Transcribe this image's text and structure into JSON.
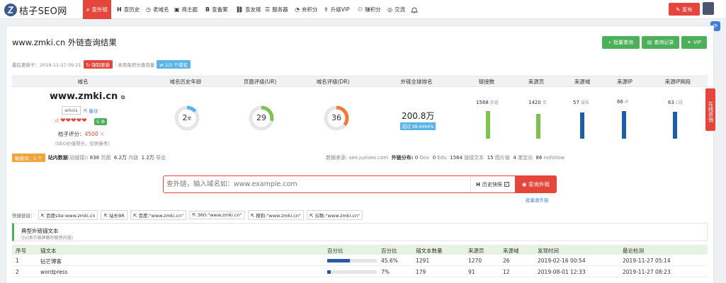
{
  "brand": {
    "name": "桔子SEO网"
  },
  "nav": {
    "items": [
      {
        "glyph": "⌕",
        "label": "查外链"
      },
      {
        "glyph": "H",
        "label": "查历史"
      },
      {
        "glyph": "◷",
        "label": "老域名"
      },
      {
        "glyph": "▣",
        "label": "商主题"
      },
      {
        "glyph": "B",
        "label": "查备案"
      },
      {
        "glyph": "⛓",
        "label": "查友链"
      },
      {
        "glyph": "☰",
        "label": "服务器"
      },
      {
        "glyph": "◔",
        "label": "充积分"
      },
      {
        "glyph": "⇪",
        "label": "升级VIP"
      },
      {
        "glyph": "⚇",
        "label": "赚积分"
      },
      {
        "glyph": "◎",
        "label": "交流"
      }
    ],
    "publish": "发布"
  },
  "header": {
    "title": "www.zmki.cn 外链查询结果",
    "buttons": {
      "batch": "批量查询",
      "records": "查询记录",
      "vip": "VIP"
    }
  },
  "meta": {
    "updated": "最后更新于：2019-11-27 09:21",
    "force": "强制更新",
    "free": "本周免积分查询量",
    "quota": "2/2 个域名"
  },
  "stats": {
    "headers": [
      "域名",
      "域名历史年龄",
      "页面评级(UR)",
      "域名评级(DR)",
      "外链全球排名",
      "链接数",
      "来源页",
      "来源域",
      "来源IP",
      "来源IP网段"
    ],
    "domain": "www.zmki.cn",
    "whois": "whois",
    "beian": "备住",
    "hearts": "❤❤❤❤❤",
    "heart_badge": "5",
    "score_label": "桔子评分：",
    "score": "4500 ☆",
    "score_note": "(SEO价值得分，仅供参考)",
    "age": "2",
    "age_unit": "年",
    "age_ratio": 0.14,
    "ur": 29,
    "dr": 36,
    "rank": "200.8万",
    "rank_pct": "超过 98.6494%",
    "counts": [
      {
        "value": "1568",
        "unit": "外链",
        "level": 0.75,
        "color": "#7dc34f"
      },
      {
        "value": "1420",
        "unit": "页",
        "level": 0.68,
        "color": "#7dc34f"
      },
      {
        "value": "57",
        "unit": "域名",
        "level": 0.72,
        "color": "#1c5fa8"
      },
      {
        "value": "66",
        "unit": "IP",
        "level": 0.75,
        "color": "#1c5fa8"
      },
      {
        "value": "63",
        "unit": "C段",
        "level": 0.73,
        "color": "#1c5fa8"
      }
    ]
  },
  "ext": {
    "keyword": "敏感词：1 个",
    "site_label": "站内数据",
    "site_note": "(站链接)",
    "n838": "838",
    "pages": "页面",
    "n62": "6.2万",
    "inner": "内链",
    "n12": "1.2万",
    "out": "导出",
    "source": "数据来源: seo.juziseo.com",
    "dist": "外链分布:",
    "gov_n": "0",
    "gov": "Gov",
    "edu_n": "0",
    "edu": "Edu",
    "txt_n": "1564",
    "txt": "链接文本",
    "img_n": "15",
    "img": "图片链",
    "redir_n": "4",
    "redir": "重定向",
    "nf_n": "86",
    "nf": "nofollow"
  },
  "search": {
    "placeholder": "查外链，输入域名如：www.example.com",
    "history": "历史快照",
    "button": "查询外链",
    "batch": "批量查外链"
  },
  "quick": {
    "label": "快捷链接：",
    "links": [
      "百度site:www.zmki.cn",
      "站长BR",
      "百度:\"www.zmki.cn\"",
      "360:\"www.zmki.cn\"",
      "搜狗:\"www.zmki.cn\"",
      "谷歌:\"www.zmki.cn\""
    ]
  },
  "typical": {
    "title": "典型外链锚文本",
    "sub": "([x]表示被屏蔽的敏感内容)"
  },
  "anchors": {
    "headers": [
      "序号",
      "锚文本",
      "百分比",
      "百分比",
      "锚文本数量",
      "来源页",
      "来源域",
      "发现时间",
      "最近检测"
    ],
    "rows": [
      {
        "idx": "1",
        "text": "钻芒博客",
        "share": 0.456,
        "pct": "45.6%",
        "count": "1291",
        "pages": "1270",
        "domains": "26",
        "found": "2019-02-16 00:54",
        "checked": "2019-11-27 05:14"
      },
      {
        "idx": "2",
        "text": "wordpress",
        "share": 0.07,
        "pct": "7%",
        "count": "179",
        "pages": "91",
        "domains": "12",
        "found": "2019-08-01 12:33",
        "checked": "2019-11-27 08:23"
      }
    ]
  },
  "float": {
    "label": "在线咨询"
  }
}
